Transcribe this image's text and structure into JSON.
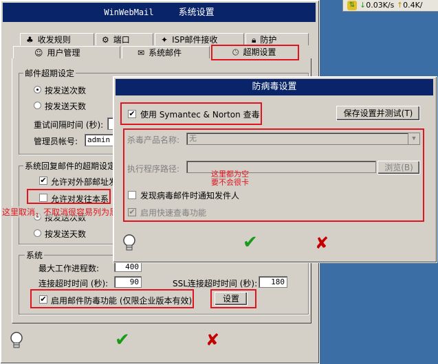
{
  "taskbar": {
    "download": "0.03K/s",
    "upload": "0.4K/"
  },
  "main": {
    "title": "WinWebMail",
    "title2": "系统设置",
    "tabs_row1": [
      "收发规则",
      "端口",
      "ISP邮件接收",
      "防护"
    ],
    "tabs_row2": [
      "用户管理",
      "系统邮件",
      "超期设置"
    ],
    "timeout_group": {
      "label": "邮件超期设定",
      "radio1": "按发送次数",
      "radio2": "按发送天数",
      "retry_label": "重试间隔时间 (秒):",
      "admin_label": "管理员帐号:",
      "admin_value": "admin"
    },
    "reply_group": {
      "label": "系统回复邮件的超期设定",
      "chk1": "允许对外部邮址发",
      "chk2": "允许对发往本系",
      "radio1": "按发送次数",
      "radio2": "按发送天数"
    },
    "system_group": {
      "label": "系统",
      "max_proc_label": "最大工作进程数:",
      "max_proc_value": "400",
      "conn_timeout_label": "连接超时时间 (秒):",
      "conn_timeout_value": "90",
      "ssl_timeout_label": "SSL连接超时时间 (秒):",
      "ssl_timeout_value": "180",
      "antivirus_chk": "启用邮件防毒功能 (仅限企业版本有效)",
      "settings_button": "设置"
    }
  },
  "dialog": {
    "title": "防病毒设置",
    "use_chk": "使用 Symantec & Norton 查毒",
    "save_button": "保存设置并测试(T)",
    "product_label": "杀毒产品名称:",
    "product_value": "无",
    "path_label": "执行程序路径:",
    "browse_button": "浏览(B)",
    "notify_chk": "发现病毒邮件时通知发件人",
    "fast_chk": "启用快速查毒功能"
  },
  "annotations": {
    "note_dialog": "这里都为空\n要不会很卡",
    "note_main": "这里取消，不取消很容易列为黑名单"
  }
}
